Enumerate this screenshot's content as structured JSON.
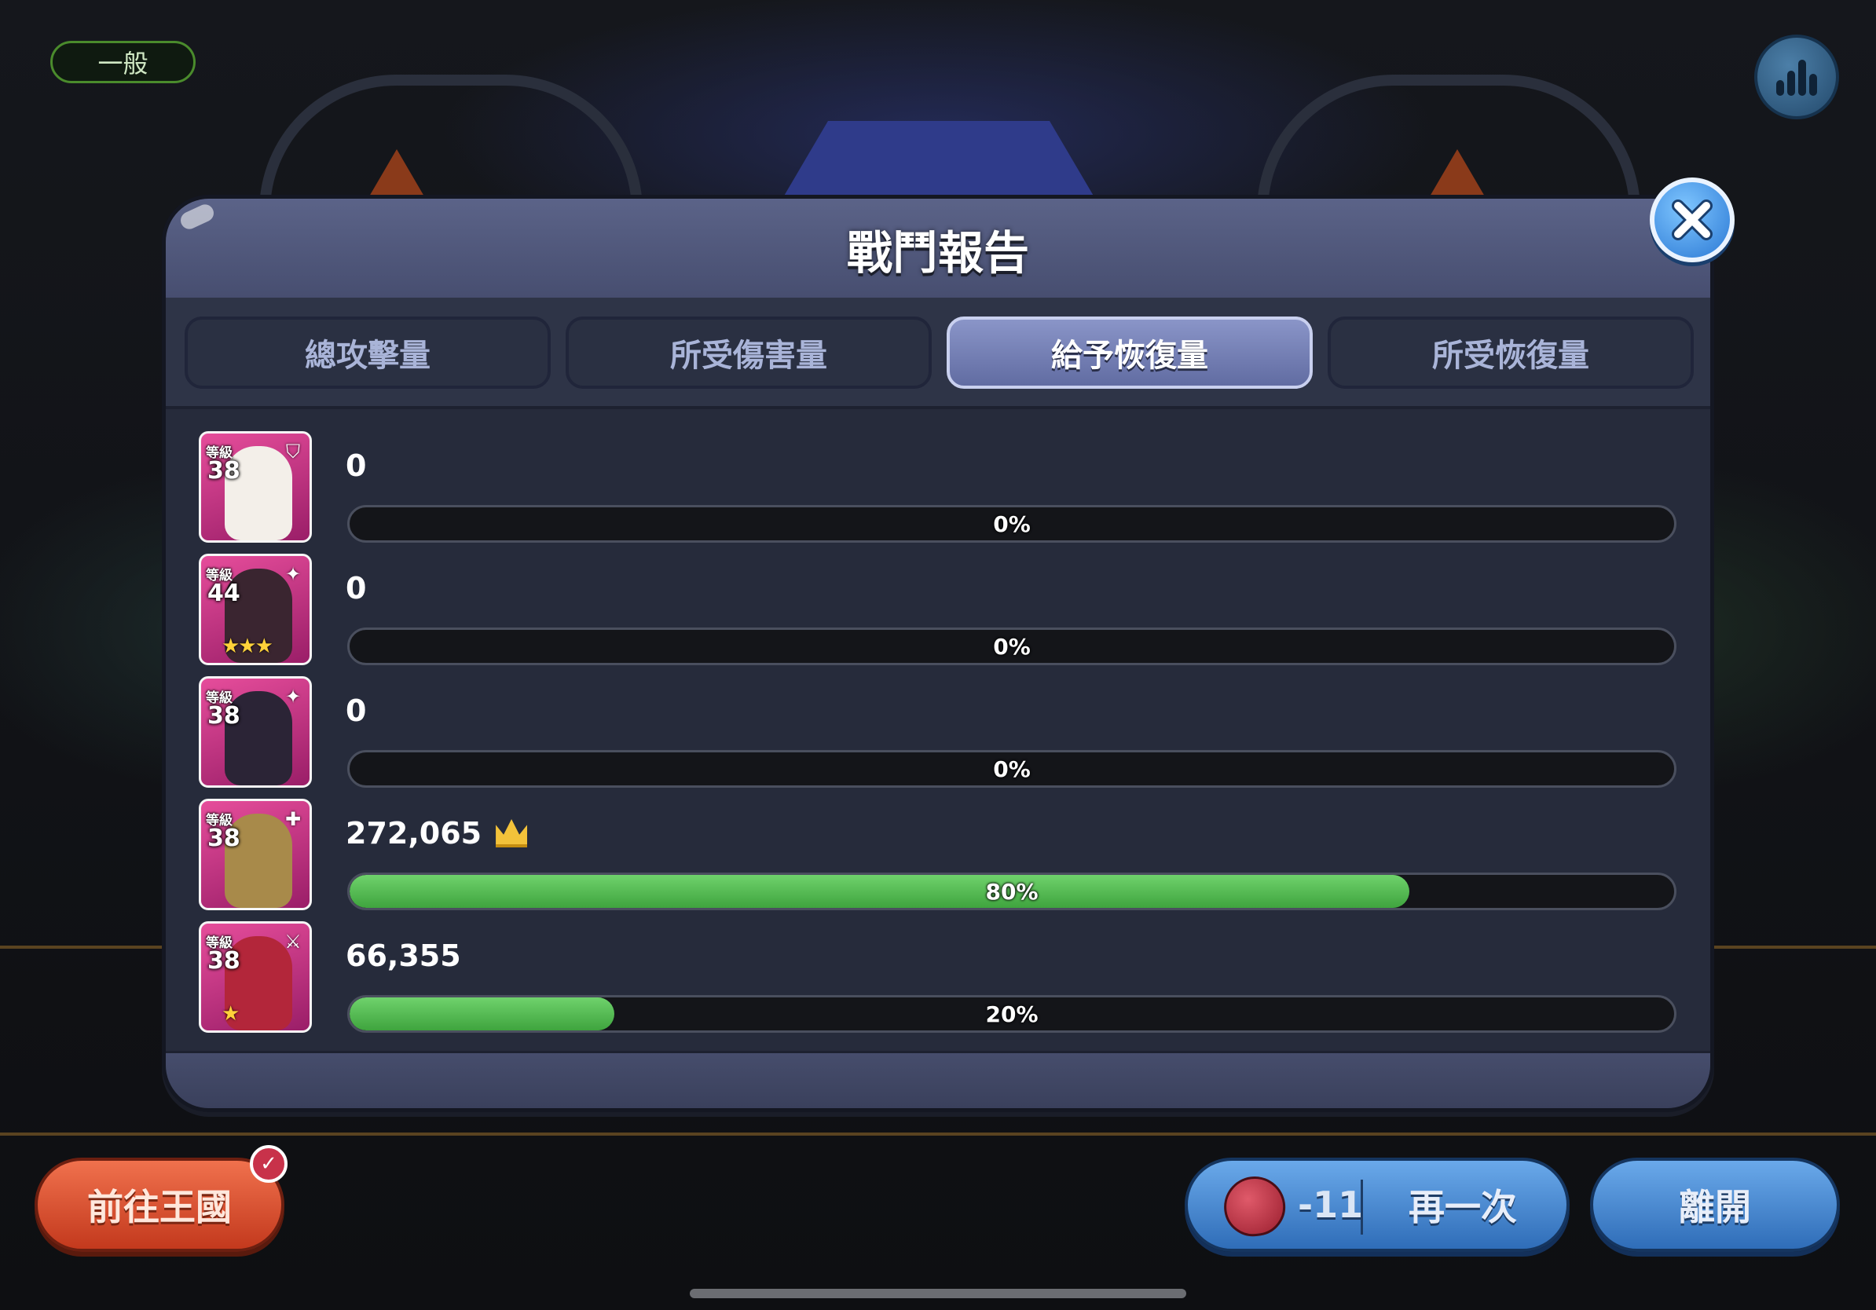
{
  "mode_label": "一般",
  "panel": {
    "title": "戰鬥報告",
    "tabs": [
      {
        "label": "總攻擊量",
        "active": false
      },
      {
        "label": "所受傷害量",
        "active": false
      },
      {
        "label": "給予恢復量",
        "active": true
      },
      {
        "label": "所受恢復量",
        "active": false
      }
    ]
  },
  "level_tag": "等級",
  "rows": [
    {
      "level": "38",
      "class_icon": "shield-icon",
      "value": "0",
      "percent_label": "0%",
      "fraction": 0.0,
      "top_healer": false,
      "stars": "",
      "colors": {
        "figure": "#f3efe9"
      }
    },
    {
      "level": "44",
      "class_icon": "sparkle-icon",
      "value": "0",
      "percent_label": "0%",
      "fraction": 0.0,
      "top_healer": false,
      "stars": "★★★",
      "colors": {
        "figure": "#3a2530"
      }
    },
    {
      "level": "38",
      "class_icon": "sparkle-icon",
      "value": "0",
      "percent_label": "0%",
      "fraction": 0.0,
      "top_healer": false,
      "stars": "",
      "colors": {
        "figure": "#2b2436"
      }
    },
    {
      "level": "38",
      "class_icon": "plus-icon",
      "value": "272,065",
      "percent_label": "80%",
      "fraction": 0.8,
      "top_healer": true,
      "stars": "",
      "colors": {
        "figure": "#a88a4a"
      }
    },
    {
      "level": "38",
      "class_icon": "sword-icon",
      "value": "66,355",
      "percent_label": "20%",
      "fraction": 0.2,
      "top_healer": false,
      "stars": "★",
      "colors": {
        "figure": "#b3263a"
      }
    }
  ],
  "buttons": {
    "kingdom": "前往王國",
    "retry_cost": "-11",
    "retry": "再一次",
    "leave": "離開"
  },
  "colors": {
    "bar_fill": "#4caf50",
    "active_tab": "#6f7ab0",
    "panel": "#262b3b"
  }
}
